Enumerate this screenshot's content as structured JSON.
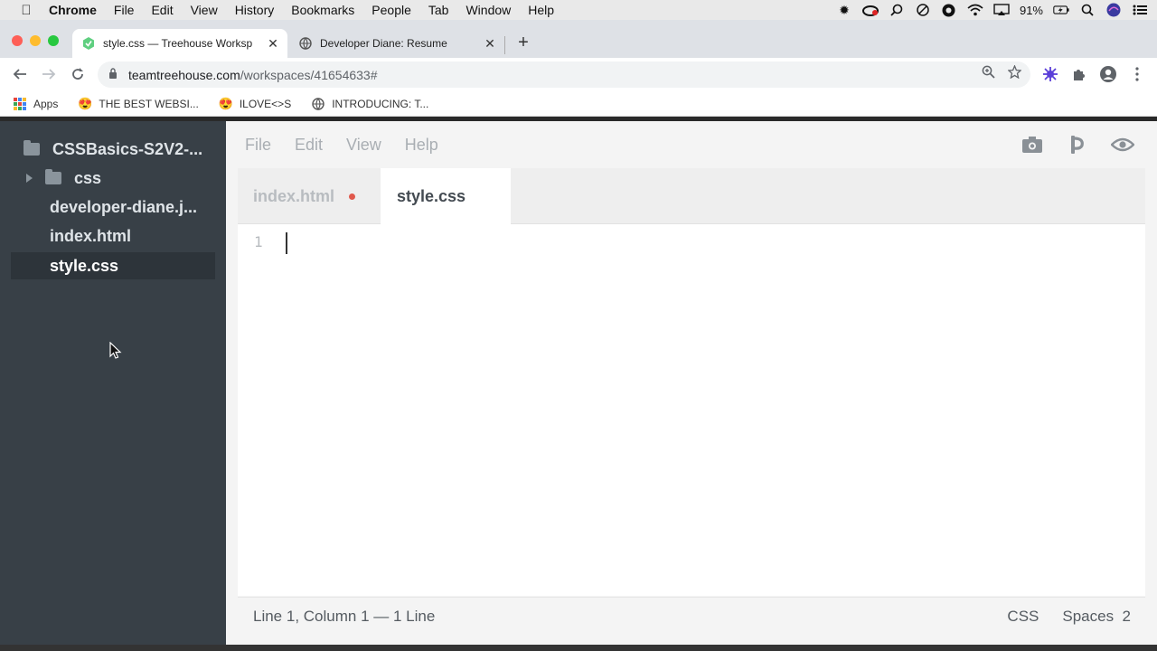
{
  "menubar": {
    "app": "Chrome",
    "items": [
      "File",
      "Edit",
      "View",
      "History",
      "Bookmarks",
      "People",
      "Tab",
      "Window",
      "Help"
    ],
    "battery": "91%"
  },
  "tabs": [
    {
      "title": "style.css — Treehouse Worksp",
      "active": true
    },
    {
      "title": "Developer Diane: Resume",
      "active": false
    }
  ],
  "omnibox": {
    "host": "teamtreehouse.com",
    "path": "/workspaces/41654633#"
  },
  "bookmarks": [
    {
      "label": "Apps"
    },
    {
      "label": "THE BEST WEBSI..."
    },
    {
      "label": "ILOVE<>S"
    },
    {
      "label": "INTRODUCING: T..."
    }
  ],
  "sidebar": {
    "project": "CSSBasics-S2V2-...",
    "items": [
      {
        "label": "css",
        "type": "folder"
      },
      {
        "label": "developer-diane.j...",
        "type": "file"
      },
      {
        "label": "index.html",
        "type": "file"
      },
      {
        "label": "style.css",
        "type": "file",
        "selected": true
      }
    ]
  },
  "editor_menu": [
    "File",
    "Edit",
    "View",
    "Help"
  ],
  "editor_tabs": [
    {
      "label": "index.html",
      "modified": true,
      "active": false
    },
    {
      "label": "style.css",
      "modified": false,
      "active": true
    }
  ],
  "editor": {
    "line_numbers": [
      "1"
    ]
  },
  "statusbar": {
    "position": "Line 1, Column 1 — 1 Line",
    "language": "CSS",
    "indent": "Spaces  2"
  },
  "colors": {
    "sidebar_bg": "#384047",
    "modified_dot": "#e0584c"
  }
}
